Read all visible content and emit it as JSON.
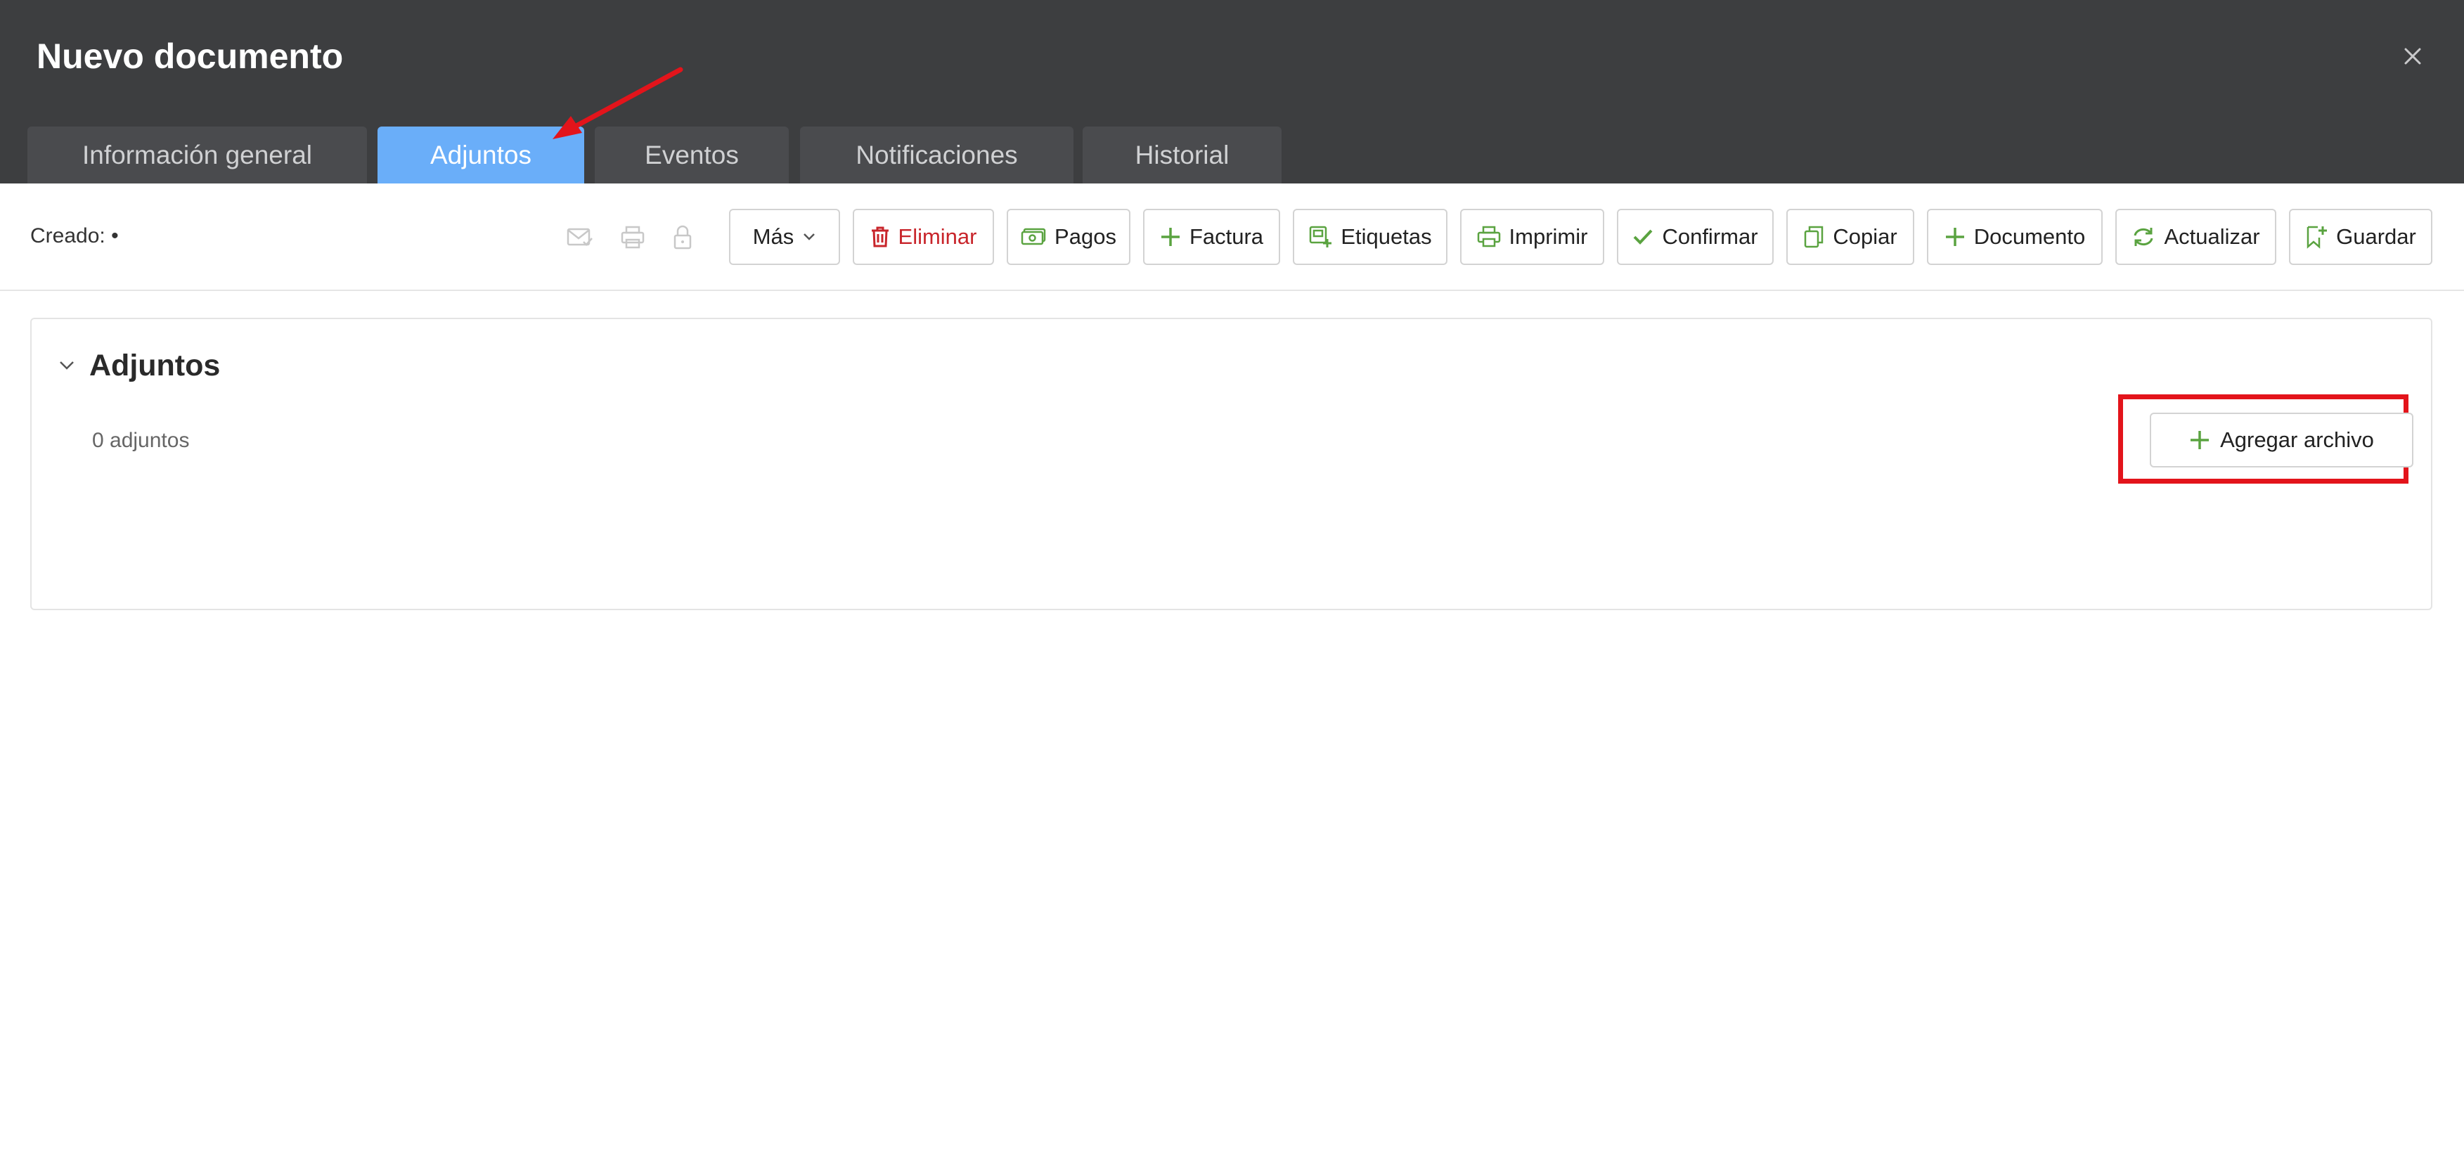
{
  "dialog": {
    "title": "Nuevo documento"
  },
  "tabs": [
    {
      "label": "Información general",
      "active": false
    },
    {
      "label": "Adjuntos",
      "active": true
    },
    {
      "label": "Eventos",
      "active": false
    },
    {
      "label": "Notificaciones",
      "active": false
    },
    {
      "label": "Historial",
      "active": false
    }
  ],
  "toolbar": {
    "created_label": "Creado: •",
    "disabled_icons": [
      "mail-check-icon",
      "print-icon",
      "lock-icon"
    ],
    "buttons": [
      {
        "label": "Más",
        "icon": "chevron-down-icon"
      },
      {
        "label": "Eliminar",
        "icon": "trash-icon"
      },
      {
        "label": "Pagos",
        "icon": "money-icon"
      },
      {
        "label": "Factura",
        "icon": "plus-icon"
      },
      {
        "label": "Etiquetas",
        "icon": "tag-add-icon"
      },
      {
        "label": "Imprimir",
        "icon": "print-icon"
      },
      {
        "label": "Confirmar",
        "icon": "check-icon"
      },
      {
        "label": "Copiar",
        "icon": "copy-icon"
      },
      {
        "label": "Documento",
        "icon": "plus-icon"
      },
      {
        "label": "Actualizar",
        "icon": "refresh-icon"
      },
      {
        "label": "Guardar",
        "icon": "bookmark-save-icon"
      }
    ]
  },
  "attachments": {
    "title": "Adjuntos",
    "count_text": "0 adjuntos",
    "add_button_label": "Agregar archivo"
  },
  "colors": {
    "header_bg": "#3d3e40",
    "tab_bg": "#4a4b4e",
    "tab_active_bg": "#6aaef9",
    "icon_green": "#5aa340",
    "danger_red": "#c8252b",
    "annotation_red": "#e3141b"
  }
}
